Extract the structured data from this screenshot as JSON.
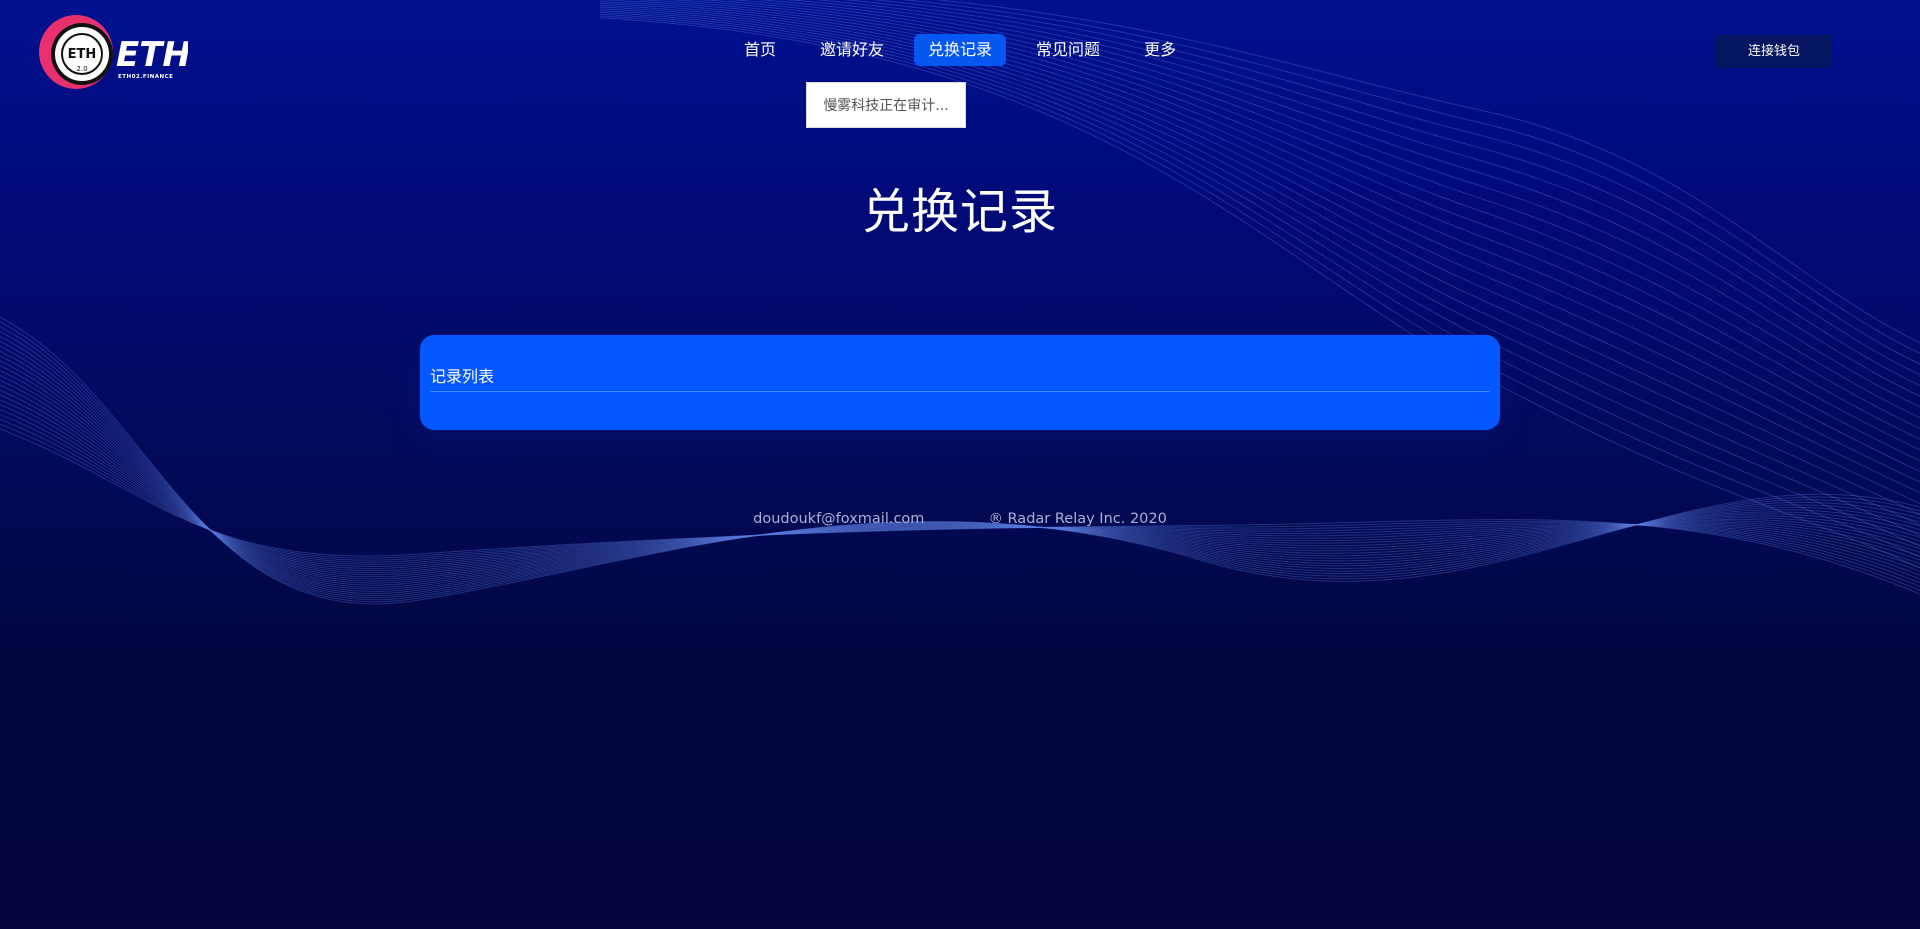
{
  "header": {
    "logo_text": "ETH",
    "logo_badge": "ETH",
    "logo_badge_sub": "2.0",
    "logo_subtitle": "ETH02.FINANCE",
    "nav": [
      {
        "label": "首页"
      },
      {
        "label": "邀请好友"
      },
      {
        "label": "兑换记录",
        "active": true
      },
      {
        "label": "常见问题"
      },
      {
        "label": "更多"
      }
    ],
    "dropdown_text": "慢雾科技正在审计...",
    "connect_button": "连接钱包"
  },
  "main": {
    "title": "兑换记录",
    "card_title": "记录列表"
  },
  "footer": {
    "email": "doudoukf@foxmail.com",
    "copyright": "® Radar Relay Inc. 2020"
  },
  "colors": {
    "accent": "#0558ff",
    "active_nav": "#0657f2",
    "logo_pink": "#e8306d"
  }
}
